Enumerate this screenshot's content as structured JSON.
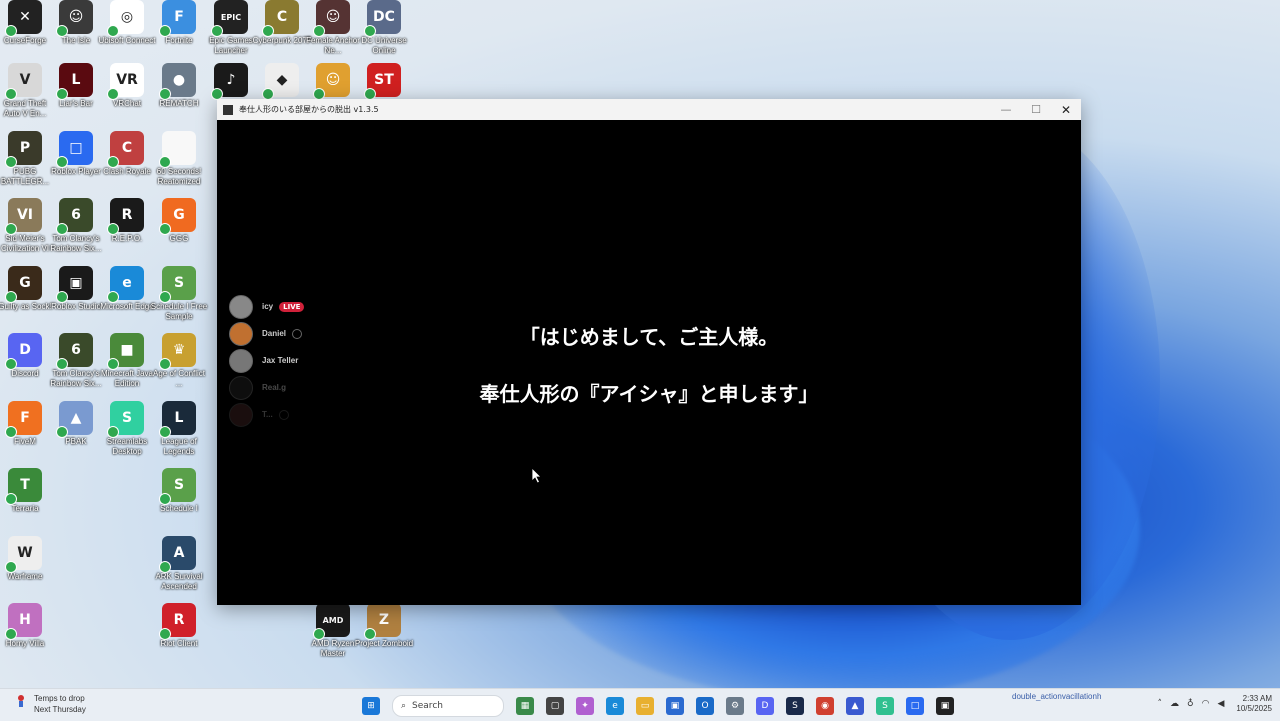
{
  "desktop": {
    "icons": [
      {
        "label": "CurseForge",
        "color": "#222222",
        "glyph": "✕"
      },
      {
        "label": "The Isle",
        "color": "#3a3a3a",
        "glyph": "☺"
      },
      {
        "label": "Ubisoft Connect",
        "color": "#ffffff",
        "glyph": "◎"
      },
      {
        "label": "Fortnite",
        "color": "#3b8fe0",
        "glyph": "F"
      },
      {
        "label": "Epic Games Launcher",
        "color": "#222222",
        "glyph": "EPIC"
      },
      {
        "label": "Cyberpunk 2077",
        "color": "#8a7a30",
        "glyph": "C"
      },
      {
        "label": "Female Anchor Ne...",
        "color": "#553333",
        "glyph": "☺"
      },
      {
        "label": "DC Universe Online",
        "color": "#5a6a8a",
        "glyph": "DC"
      },
      {
        "label": "Grand Theft Auto V En...",
        "color": "#d8d8d8",
        "glyph": "V"
      },
      {
        "label": "Liar's Bar",
        "color": "#5a0a10",
        "glyph": "L"
      },
      {
        "label": "VRChat",
        "color": "#ffffff",
        "glyph": "VR"
      },
      {
        "label": "REMATCH",
        "color": "#6a7a8a",
        "glyph": "●"
      },
      {
        "label": "",
        "color": "#1a1a1a",
        "glyph": "♪"
      },
      {
        "label": "",
        "color": "#eeeeee",
        "glyph": "◆"
      },
      {
        "label": "",
        "color": "#e0a030",
        "glyph": "☺"
      },
      {
        "label": "",
        "color": "#d02020",
        "glyph": "ST"
      },
      {
        "label": "PUBG BATTLEGR...",
        "color": "#3a3a2a",
        "glyph": "P"
      },
      {
        "label": "Roblox Player",
        "color": "#2a6af0",
        "glyph": "□"
      },
      {
        "label": "Clash Royale",
        "color": "#c04040",
        "glyph": "C"
      },
      {
        "label": "60 Seconds! Reatomized",
        "color": "#f8f8f8",
        "glyph": ""
      },
      {
        "label": "Sid Meier's Civilization VI",
        "color": "#8a7a5a",
        "glyph": "VI"
      },
      {
        "label": "Tom Clancy's Rainbow Six...",
        "color": "#3a4a2a",
        "glyph": "6"
      },
      {
        "label": "R.E.P.O.",
        "color": "#1a1a1a",
        "glyph": "R"
      },
      {
        "label": "GGG",
        "color": "#f06a20",
        "glyph": "G"
      },
      {
        "label": "Guilty as Sock!",
        "color": "#3a2a1a",
        "glyph": "G"
      },
      {
        "label": "Roblox Studio",
        "color": "#1a1a1a",
        "glyph": "▣"
      },
      {
        "label": "Microsoft Edge",
        "color": "#1a8ad8",
        "glyph": "e"
      },
      {
        "label": "Schedule I Free Sample",
        "color": "#5aa04a",
        "glyph": "S"
      },
      {
        "label": "Discord",
        "color": "#5865f2",
        "glyph": "D"
      },
      {
        "label": "Tom Clancy's Rainbow Six...",
        "color": "#3a4a2a",
        "glyph": "6"
      },
      {
        "label": "Minecraft Java Edition",
        "color": "#4a8a3a",
        "glyph": "■"
      },
      {
        "label": "Age of Conflict ...",
        "color": "#c8a030",
        "glyph": "♛"
      },
      {
        "label": "FiveM",
        "color": "#f07020",
        "glyph": "F"
      },
      {
        "label": "PBAK",
        "color": "#7a9ad0",
        "glyph": "▲"
      },
      {
        "label": "Streamlabs Desktop",
        "color": "#30d0a0",
        "glyph": "S"
      },
      {
        "label": "League of Legends",
        "color": "#1a2a3a",
        "glyph": "L"
      },
      {
        "label": "Terraria",
        "color": "#3a8a3a",
        "glyph": "T"
      },
      {
        "label": "Schedule I",
        "color": "#5aa04a",
        "glyph": "S"
      },
      {
        "label": "Warframe",
        "color": "#eeeeee",
        "glyph": "W"
      },
      {
        "label": "ARK Survival Ascended",
        "color": "#2a4a6a",
        "glyph": "A"
      },
      {
        "label": "Horny Villa",
        "color": "#c070c0",
        "glyph": "H"
      },
      {
        "label": "Riot Client",
        "color": "#d0202a",
        "glyph": "R"
      },
      {
        "label": "AMD Ryzen Master",
        "color": "#1a1a1a",
        "glyph": "AMD"
      },
      {
        "label": "Project Zomboid",
        "color": "#b08040",
        "glyph": "Z"
      }
    ]
  },
  "window": {
    "title": "奉仕人形のいる部屋からの脱出 v1.3.5",
    "minimize": "—",
    "maximize": "☐",
    "close": "✕",
    "dialogue": {
      "line1": "「はじめまして、ご主人様。",
      "line2": "奉仕人形の『アイシャ』と申します」"
    },
    "overlay": {
      "viewers": [
        {
          "name": "icy",
          "live": "LIVE",
          "color": "#888888"
        },
        {
          "name": "Daniel",
          "color": "#c07030"
        },
        {
          "name": "Jax Teller",
          "color": "#777777"
        },
        {
          "name": "Real.g",
          "color": "#2a2a2a"
        },
        {
          "name": "T...",
          "color": "#4a2a2a"
        }
      ]
    }
  },
  "taskbar": {
    "weather": {
      "line1": "Temps to drop",
      "line2": "Next Thursday"
    },
    "search_placeholder": "Search",
    "notification": "double_actionvacillationh",
    "clock": {
      "time": "2:33 AM",
      "date": "10/5/2025"
    }
  }
}
